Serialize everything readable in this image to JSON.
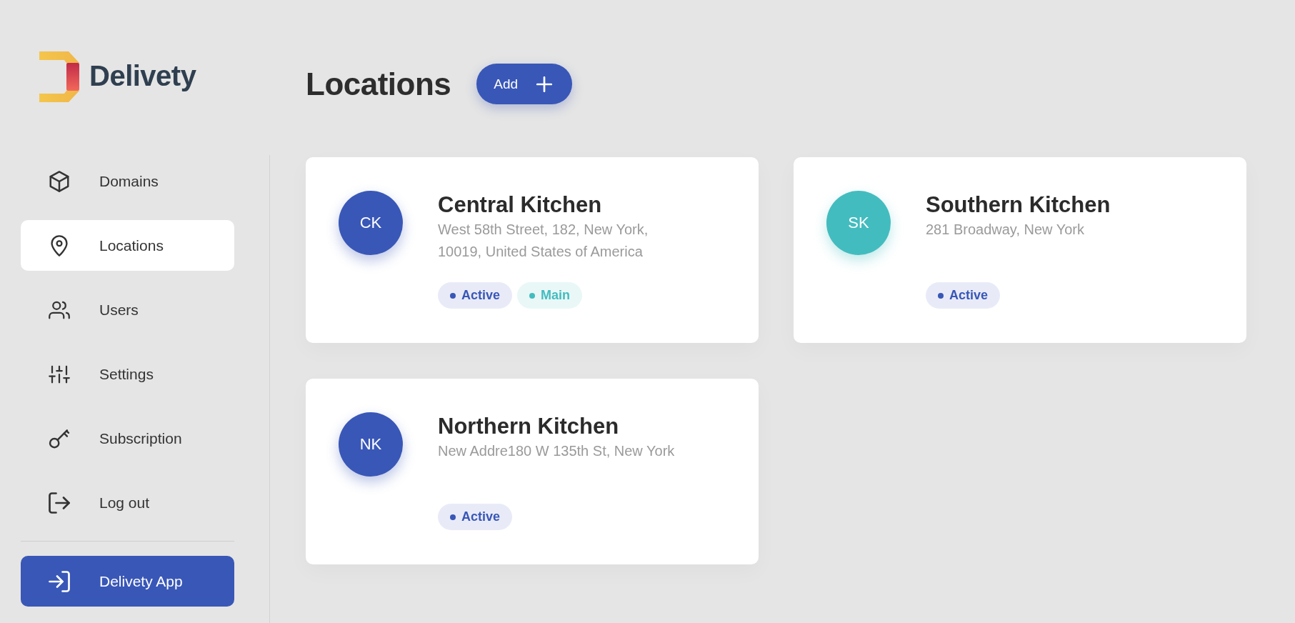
{
  "brand": {
    "name": "Delivety"
  },
  "sidebar": {
    "items": [
      {
        "label": "Domains",
        "selected": false
      },
      {
        "label": "Locations",
        "selected": true
      },
      {
        "label": "Users",
        "selected": false
      },
      {
        "label": "Settings",
        "selected": false
      },
      {
        "label": "Subscription",
        "selected": false
      },
      {
        "label": "Log out",
        "selected": false
      }
    ],
    "app_button": {
      "label": "Delivety App"
    }
  },
  "header": {
    "title": "Locations",
    "add_button": {
      "label": "Add"
    }
  },
  "locations": [
    {
      "initials": "CK",
      "color": "#3957b7",
      "name": "Central Kitchen",
      "address": "West 58th Street, 182, New York, 10019, United States of America",
      "tags": [
        {
          "label": "Active",
          "color": "#3957b7"
        },
        {
          "label": "Main",
          "color": "#43bcbf"
        }
      ]
    },
    {
      "initials": "SK",
      "color": "#43bcbf",
      "name": "Southern Kitchen",
      "address": "281 Broadway, New York",
      "tags": [
        {
          "label": "Active",
          "color": "#3957b7"
        }
      ]
    },
    {
      "initials": "NK",
      "color": "#3957b7",
      "name": "Northern Kitchen",
      "address": "New Addre180 W 135th St, New York",
      "tags": [
        {
          "label": "Active",
          "color": "#3957b7"
        }
      ]
    }
  ]
}
